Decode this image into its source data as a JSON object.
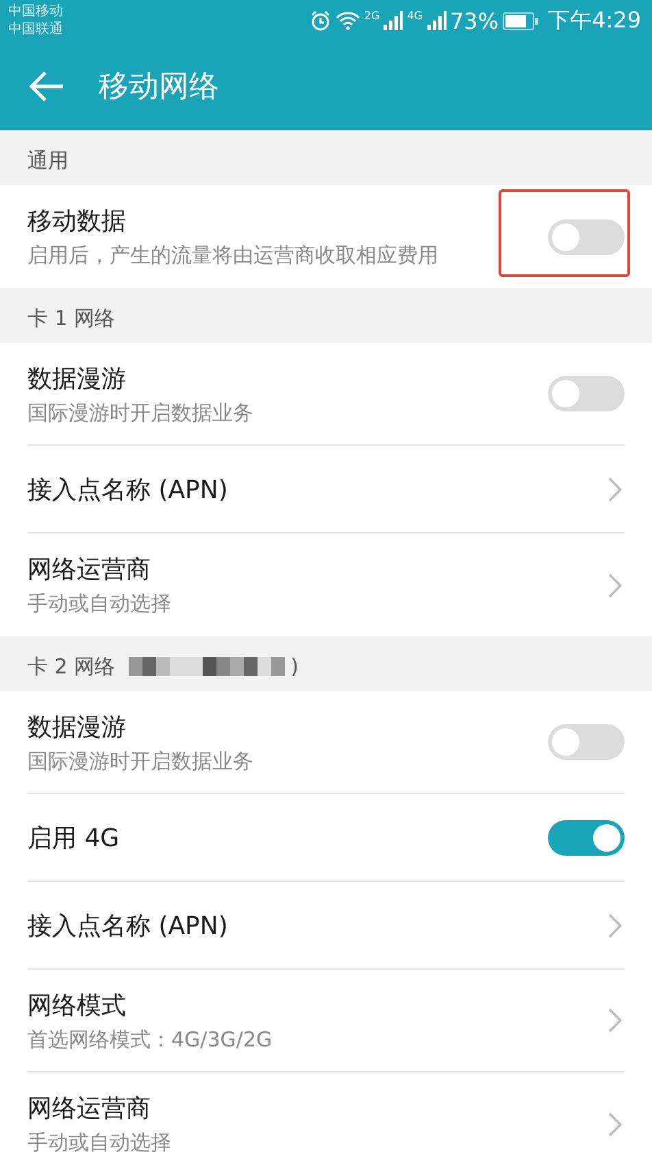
{
  "status_bar": {
    "carriers": [
      "中国移动",
      "中国联通"
    ],
    "signals": [
      {
        "label": "2G"
      },
      {
        "label": "4G"
      }
    ],
    "battery": "73%",
    "time": "下午4:29"
  },
  "app_bar": {
    "title": "移动网络"
  },
  "sections": [
    {
      "header": "通用",
      "items": [
        {
          "kind": "toggle",
          "title": "移动数据",
          "subtitle": "启用后，产生的流量将由运营商收取相应费用",
          "on": false,
          "annotated": true
        }
      ]
    },
    {
      "header": "卡 1 网络",
      "items": [
        {
          "kind": "toggle",
          "title": "数据漫游",
          "subtitle": "国际漫游时开启数据业务",
          "on": false,
          "annotated": false
        },
        {
          "kind": "link",
          "title": "接入点名称 (APN)"
        },
        {
          "kind": "link",
          "title": "网络运营商",
          "subtitle": "手动或自动选择"
        }
      ]
    },
    {
      "header": "卡 2 网络",
      "header_suffix": ")",
      "redacted": true,
      "items": [
        {
          "kind": "toggle",
          "title": "数据漫游",
          "subtitle": "国际漫游时开启数据业务",
          "on": false,
          "annotated": false
        },
        {
          "kind": "toggle",
          "title": "启用 4G",
          "on": true,
          "annotated": false
        },
        {
          "kind": "link",
          "title": "接入点名称 (APN)"
        },
        {
          "kind": "link",
          "title": "网络模式",
          "subtitle": "首选网络模式：4G/3G/2G"
        },
        {
          "kind": "link",
          "title": "网络运营商",
          "subtitle": "手动或自动选择"
        }
      ]
    }
  ]
}
